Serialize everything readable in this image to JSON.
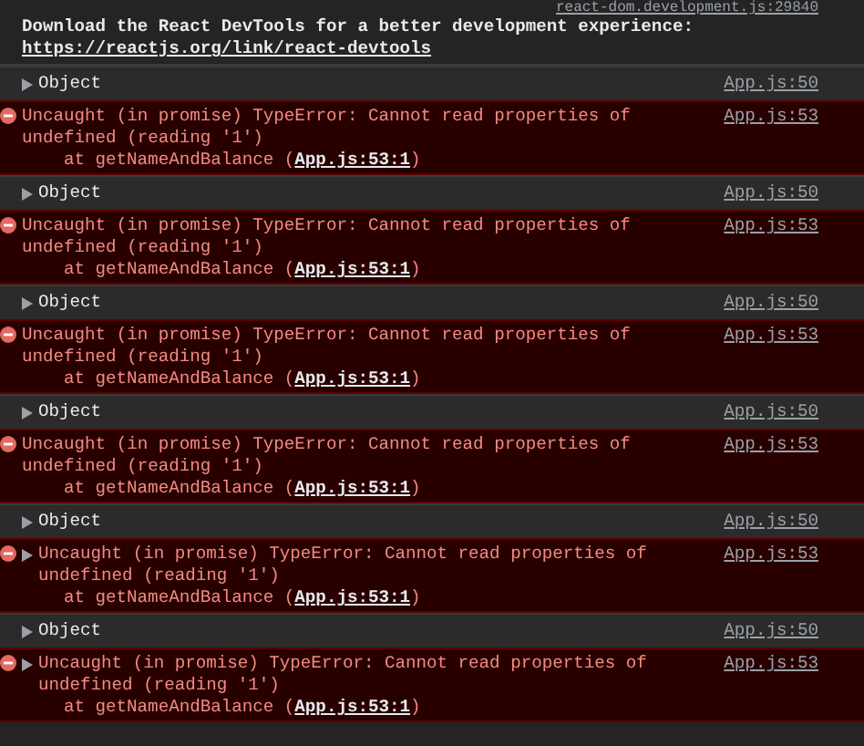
{
  "top_source": "react-dom.development.js:29840",
  "banner": {
    "text": "Download the React DevTools for a better development experience: ",
    "link": "https://reactjs.org/link/react-devtools"
  },
  "entries": [
    {
      "kind": "log",
      "expanded": false,
      "label": "Object",
      "source": "App.js:50"
    },
    {
      "kind": "error",
      "expandable": false,
      "message": "Uncaught (in promise) TypeError: Cannot read properties of undefined (reading '1')",
      "stack_text": "at getNameAndBalance (",
      "stack_link": "App.js:53:1",
      "stack_end": ")",
      "source": "App.js:53"
    },
    {
      "kind": "log",
      "expanded": false,
      "label": "Object",
      "source": "App.js:50"
    },
    {
      "kind": "error",
      "expandable": false,
      "message": "Uncaught (in promise) TypeError: Cannot read properties of undefined (reading '1')",
      "stack_text": "at getNameAndBalance (",
      "stack_link": "App.js:53:1",
      "stack_end": ")",
      "source": "App.js:53"
    },
    {
      "kind": "log",
      "expanded": false,
      "label": "Object",
      "source": "App.js:50"
    },
    {
      "kind": "error",
      "expandable": false,
      "message": "Uncaught (in promise) TypeError: Cannot read properties of undefined (reading '1')",
      "stack_text": "at getNameAndBalance (",
      "stack_link": "App.js:53:1",
      "stack_end": ")",
      "source": "App.js:53"
    },
    {
      "kind": "log",
      "expanded": false,
      "label": "Object",
      "source": "App.js:50"
    },
    {
      "kind": "error",
      "expandable": false,
      "message": "Uncaught (in promise) TypeError: Cannot read properties of undefined (reading '1')",
      "stack_text": "at getNameAndBalance (",
      "stack_link": "App.js:53:1",
      "stack_end": ")",
      "source": "App.js:53"
    },
    {
      "kind": "log",
      "expanded": false,
      "label": "Object",
      "source": "App.js:50"
    },
    {
      "kind": "error",
      "expandable": true,
      "message": "Uncaught (in promise) TypeError: Cannot read properties of undefined (reading '1')",
      "stack_text": "at getNameAndBalance (",
      "stack_link": "App.js:53:1",
      "stack_end": ")",
      "source": "App.js:53"
    },
    {
      "kind": "log",
      "expanded": false,
      "label": "Object",
      "source": "App.js:50"
    },
    {
      "kind": "error",
      "expandable": true,
      "message": "Uncaught (in promise) TypeError: Cannot read properties of undefined (reading '1')",
      "stack_text": "at getNameAndBalance (",
      "stack_link": "App.js:53:1",
      "stack_end": ")",
      "source": "App.js:53"
    }
  ]
}
